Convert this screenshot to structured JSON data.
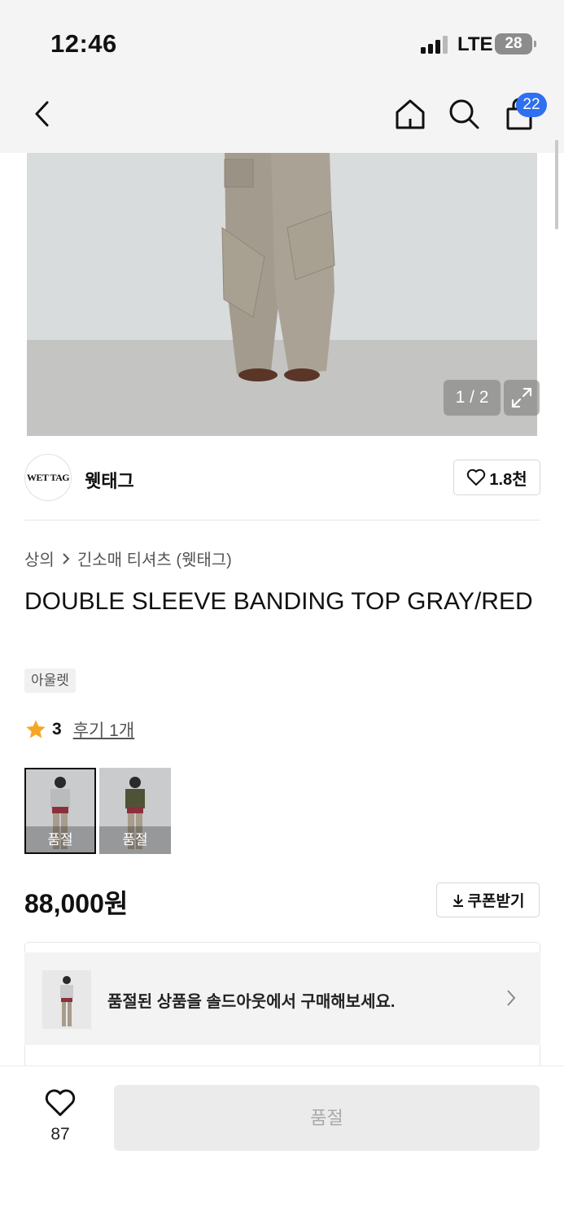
{
  "status_bar": {
    "time": "12:46",
    "network": "LTE",
    "battery": "28"
  },
  "nav": {
    "back_icon": "chevron-left-icon",
    "home_icon": "home-icon",
    "search_icon": "search-icon",
    "cart_icon": "shopping-bag-icon",
    "cart_count": "22"
  },
  "gallery": {
    "counter": "1 / 2",
    "expand_icon": "expand-icon"
  },
  "brand": {
    "logo_text": "WET TAG",
    "name": "웻태그",
    "like_count": "1.8천"
  },
  "breadcrumb": {
    "category": "상의",
    "subcategory": "긴소매 티셔츠 (웻태그)"
  },
  "product": {
    "title": "DOUBLE SLEEVE BANDING TOP GRAY/RED",
    "tag": "아울렛",
    "rating": "3",
    "reviews_label": "후기 1개",
    "price": "88,000원"
  },
  "variants": [
    {
      "label": "품절",
      "selected": true,
      "color": "#b9bcbd"
    },
    {
      "label": "품절",
      "selected": false,
      "color": "#4e5338"
    }
  ],
  "coupon": {
    "label": "쿠폰받기"
  },
  "soldout_banner": {
    "text": "품절된 상품을 솔드아웃에서 구매해보세요."
  },
  "bottom": {
    "wish_count": "87",
    "buy_label": "품절"
  },
  "colors": {
    "accent_blue": "#2f6ff2",
    "star": "#f5a623"
  }
}
